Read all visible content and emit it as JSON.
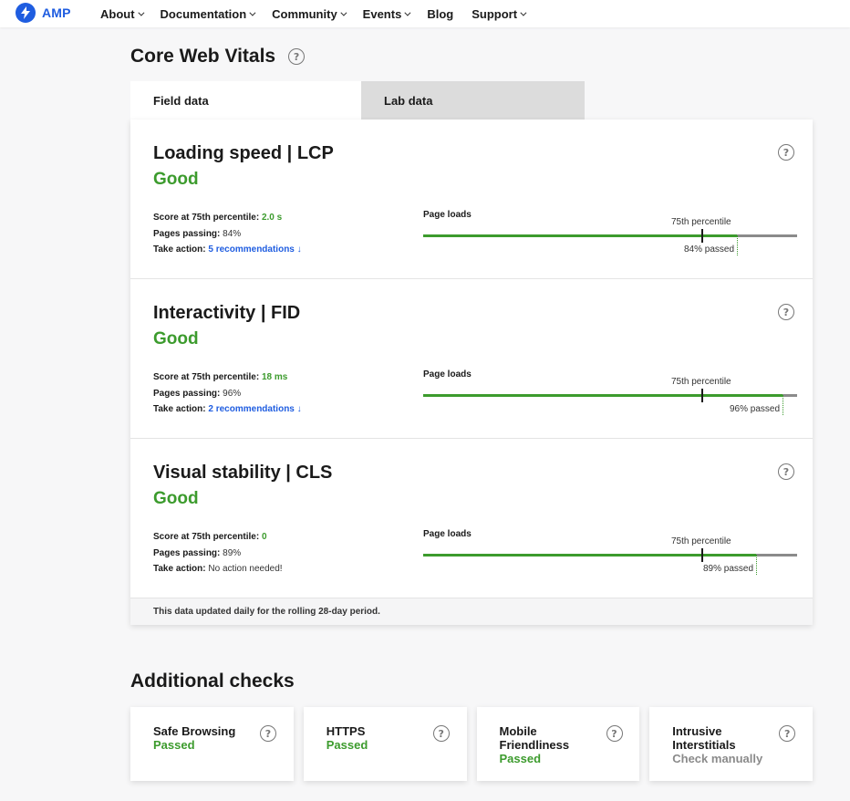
{
  "nav": {
    "logo_text": "AMP",
    "items": [
      {
        "label": "About",
        "dropdown": true
      },
      {
        "label": "Documentation",
        "dropdown": true
      },
      {
        "label": "Community",
        "dropdown": true
      },
      {
        "label": "Events",
        "dropdown": true
      },
      {
        "label": "Blog",
        "dropdown": false
      },
      {
        "label": "Support",
        "dropdown": true
      }
    ]
  },
  "cwv": {
    "title": "Core Web Vitals",
    "tabs": [
      {
        "label": "Field data",
        "active": true
      },
      {
        "label": "Lab data",
        "active": false
      }
    ],
    "metrics": [
      {
        "title": "Loading speed | LCP",
        "status": "Good",
        "score_label": "Score at 75th percentile:",
        "score_value": "2.0 s",
        "passing_label": "Pages passing:",
        "passing_value": "84%",
        "action_label": "Take action:",
        "action_value": "5 recommendations ↓",
        "page_loads_label": "Page loads",
        "percentile_label": "75th percentile",
        "passed_fraction": 0.84,
        "passed_label": "84% passed"
      },
      {
        "title": "Interactivity | FID",
        "status": "Good",
        "score_label": "Score at 75th percentile:",
        "score_value": "18 ms",
        "passing_label": "Pages passing:",
        "passing_value": "96%",
        "action_label": "Take action:",
        "action_value": "2 recommendations ↓",
        "page_loads_label": "Page loads",
        "percentile_label": "75th percentile",
        "passed_fraction": 0.96,
        "passed_label": "96% passed"
      },
      {
        "title": "Visual stability | CLS",
        "status": "Good",
        "score_label": "Score at 75th percentile:",
        "score_value": "0",
        "passing_label": "Pages passing:",
        "passing_value": "89%",
        "action_label": "Take action:",
        "action_value": "No action needed!",
        "page_loads_label": "Page loads",
        "percentile_label": "75th percentile",
        "passed_fraction": 0.89,
        "passed_label": "89% passed"
      }
    ],
    "footer": "This data updated daily for the rolling 28-day period."
  },
  "additional": {
    "title": "Additional checks",
    "checks": [
      {
        "name": "Safe Browsing",
        "status": "Passed",
        "state": "pass"
      },
      {
        "name": "HTTPS",
        "status": "Passed",
        "state": "pass"
      },
      {
        "name": "Mobile Friendliness",
        "status": "Passed",
        "state": "pass"
      },
      {
        "name": "Intrusive Interstitials",
        "status": "Check manually",
        "state": "manual"
      }
    ]
  },
  "colors": {
    "brand": "#1f5de0",
    "good": "#3c9b2d",
    "bar_gray": "#8b8b8b",
    "manual_gray": "#8a8a8a"
  },
  "icons": {
    "logo": "lightning-bolt-icon",
    "help": "question-circle-icon",
    "dropdown": "chevron-down-icon"
  }
}
